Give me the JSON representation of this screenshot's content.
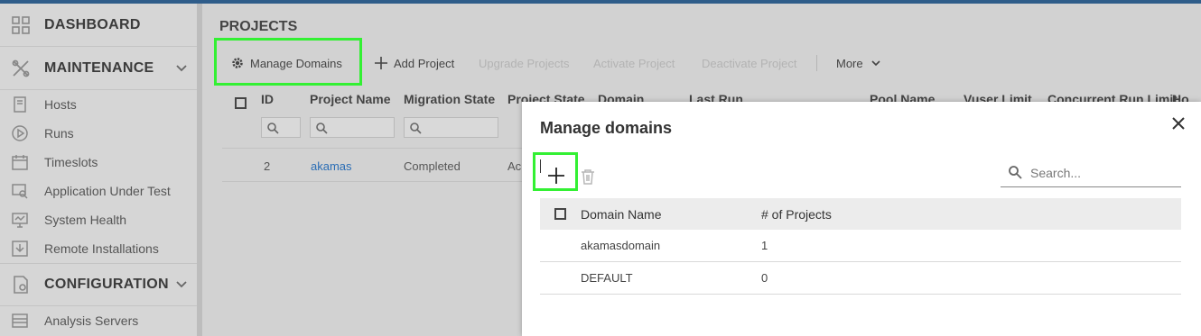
{
  "sidebar": {
    "sections": [
      {
        "label": "DASHBOARD",
        "icon": "dashboard-grid-icon"
      },
      {
        "label": "MAINTENANCE",
        "icon": "tools-icon"
      },
      {
        "label": "CONFIGURATION",
        "icon": "configuration-icon"
      }
    ],
    "items": [
      {
        "label": "Hosts",
        "icon": "host-icon"
      },
      {
        "label": "Runs",
        "icon": "play-circle-icon"
      },
      {
        "label": "Timeslots",
        "icon": "calendar-icon"
      },
      {
        "label": "Application Under Test",
        "icon": "app-search-icon"
      },
      {
        "label": "System Health",
        "icon": "monitor-icon"
      },
      {
        "label": "Remote Installations",
        "icon": "install-icon"
      },
      {
        "label": "Analysis Servers",
        "icon": "server-list-icon"
      }
    ]
  },
  "main": {
    "title": "PROJECTS",
    "toolbar": {
      "manage_domains": "Manage Domains",
      "add_project": "Add Project",
      "upgrade_projects": "Upgrade Projects",
      "activate_project": "Activate Project",
      "deactivate_project": "Deactivate Project",
      "more": "More"
    },
    "grid": {
      "columns": [
        "ID",
        "Project Name",
        "Migration State",
        "Project State",
        "Domain",
        "Last Run",
        "Pool Name",
        "Vuser Limit",
        "Concurrent Run Limit",
        "Ho"
      ],
      "rows": [
        {
          "id": "2",
          "name": "akamas",
          "migration_state": "Completed",
          "project_state": "Ac"
        }
      ]
    }
  },
  "modal": {
    "title": "Manage domains",
    "search_placeholder": "Search...",
    "columns": [
      "Domain Name",
      "# of Projects"
    ],
    "rows": [
      {
        "domain": "akamasdomain",
        "projects": "1"
      },
      {
        "domain": "DEFAULT",
        "projects": "0"
      }
    ]
  },
  "colors": {
    "highlight": "#33f033",
    "link": "#2a6db5",
    "top_bar": "#2f5d8a"
  }
}
